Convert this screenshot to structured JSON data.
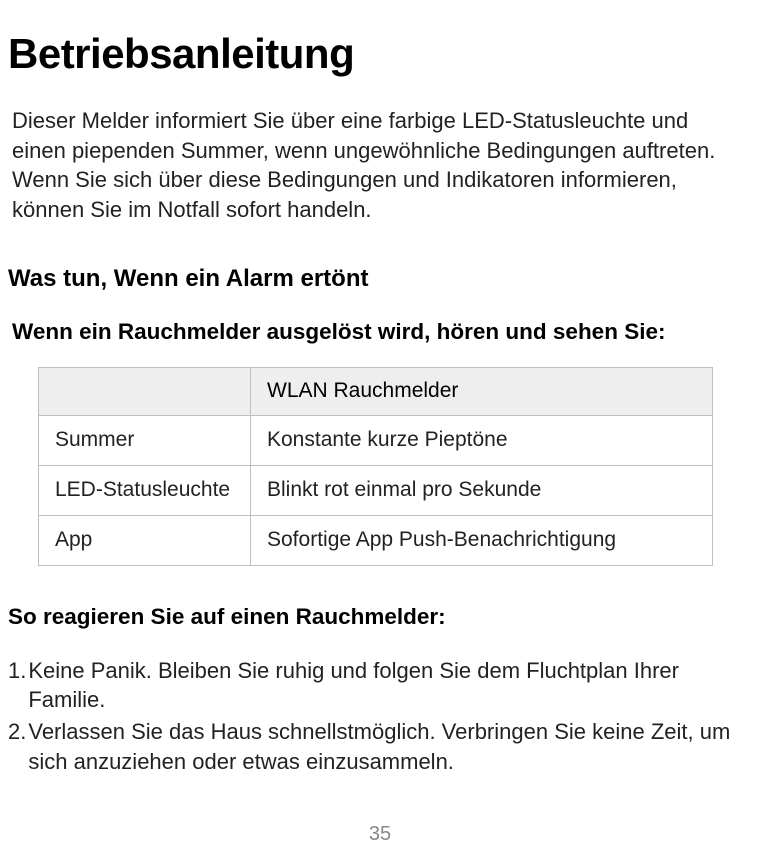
{
  "title": "Betriebsanleitung",
  "intro": "Dieser Melder informiert Sie über eine farbige LED-Statusleuchte und einen piependen Summer, wenn ungewöhnliche Bedingungen auftreten. Wenn Sie sich über diese Bedingungen und Indikatoren informieren, können Sie im Notfall sofort handeln.",
  "section_alarm_heading": "Was tun, Wenn ein Alarm ertönt",
  "section_trigger_heading": "Wenn ein Rauchmelder ausgelöst wird, hören und sehen Sie:",
  "table": {
    "header_left": "",
    "header_right": "WLAN Rauchmelder",
    "rows": [
      {
        "label": "Summer",
        "value": "Konstante kurze Pieptöne"
      },
      {
        "label": "LED-Statusleuchte",
        "value": "Blinkt rot einmal pro Sekunde"
      },
      {
        "label": "App",
        "value": "Sofortige App Push-Benachrichtigung"
      }
    ]
  },
  "section_react_heading": "So reagieren Sie auf einen Rauchmelder:",
  "steps": [
    "Keine Panik. Bleiben Sie ruhig und folgen Sie dem Fluchtplan Ihrer Familie.",
    "Verlassen Sie das Haus schnellstmöglich. Verbringen Sie keine Zeit, um sich anzuziehen oder etwas einzusammeln."
  ],
  "page_number": "35"
}
